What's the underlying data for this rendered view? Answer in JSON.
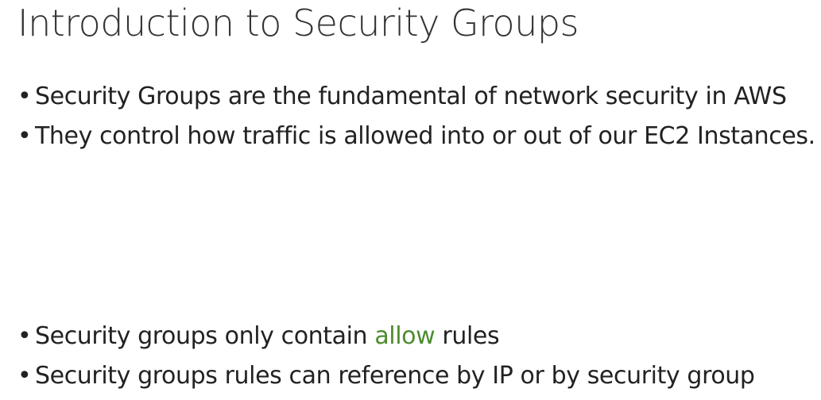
{
  "slide": {
    "title": "Introduction to Security Groups"
  },
  "bullets_top": [
    "Security Groups are the fundamental of network security in AWS",
    "They control how traffic is allowed into or out of our EC2 Instances."
  ],
  "bullets_bottom": {
    "item1": {
      "before": "Security groups only contain ",
      "highlight": "allow",
      "after": " rules"
    },
    "item2": "Security groups rules can reference by IP or by security group"
  },
  "colors": {
    "highlight": "#4c8c2e",
    "text": "#222222"
  },
  "bullet_glyph": "•"
}
